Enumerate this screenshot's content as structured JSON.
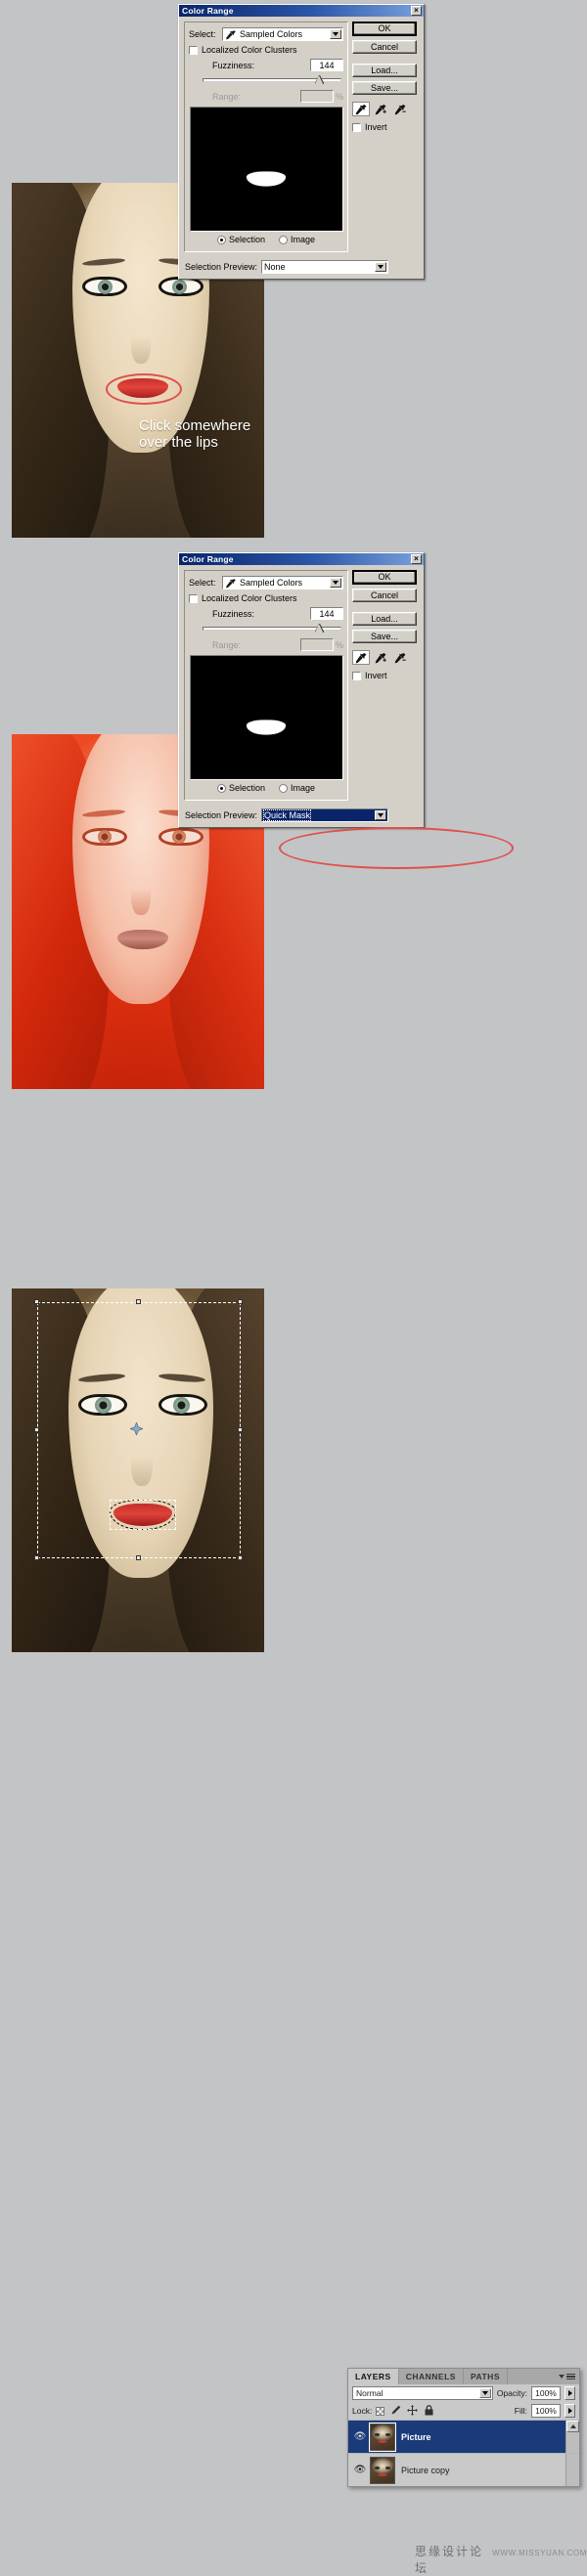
{
  "dialog": {
    "title": "Color Range",
    "close_label": "×",
    "select_label": "Select:",
    "select_value": "Sampled Colors",
    "localized_label": "Localized Color Clusters",
    "fuzziness_label": "Fuzziness:",
    "fuzziness_value": "144",
    "range_label": "Range:",
    "range_value": "",
    "percent_label": "%",
    "radio_selection": "Selection",
    "radio_image": "Image",
    "preview_label": "Selection Preview:",
    "buttons": {
      "ok": "OK",
      "cancel": "Cancel",
      "load": "Load...",
      "save": "Save...",
      "invert": "Invert"
    },
    "eyedroppers": [
      "eyedropper",
      "eyedropper-plus",
      "eyedropper-minus"
    ]
  },
  "step1": {
    "preview_value": "None",
    "instruction_line1": "Click somewhere",
    "instruction_line2": "over the lips"
  },
  "step2": {
    "preview_value": "Quick Mask"
  },
  "layers": {
    "tabs": [
      "LAYERS",
      "CHANNELS",
      "PATHS"
    ],
    "active_tab": "LAYERS",
    "blend_mode": "Normal",
    "opacity_label": "Opacity:",
    "opacity_value": "100%",
    "lock_label": "Lock:",
    "fill_label": "Fill:",
    "fill_value": "100%",
    "items": [
      {
        "name": "Picture",
        "selected": true
      },
      {
        "name": "Picture copy",
        "selected": false
      }
    ]
  },
  "watermark": {
    "cn": "思缘设计论坛",
    "en": "WWW.MISSYUAN.COM"
  },
  "colors": {
    "dialog_face": "#d4d0c8",
    "titlebar_start": "#0a246a",
    "titlebar_end": "#7ba2dd",
    "selection_highlight": "#0a246a",
    "annotation_red": "#e0504c",
    "layer_selected": "#1b3a7a",
    "page_background": "#c3c4c6"
  }
}
